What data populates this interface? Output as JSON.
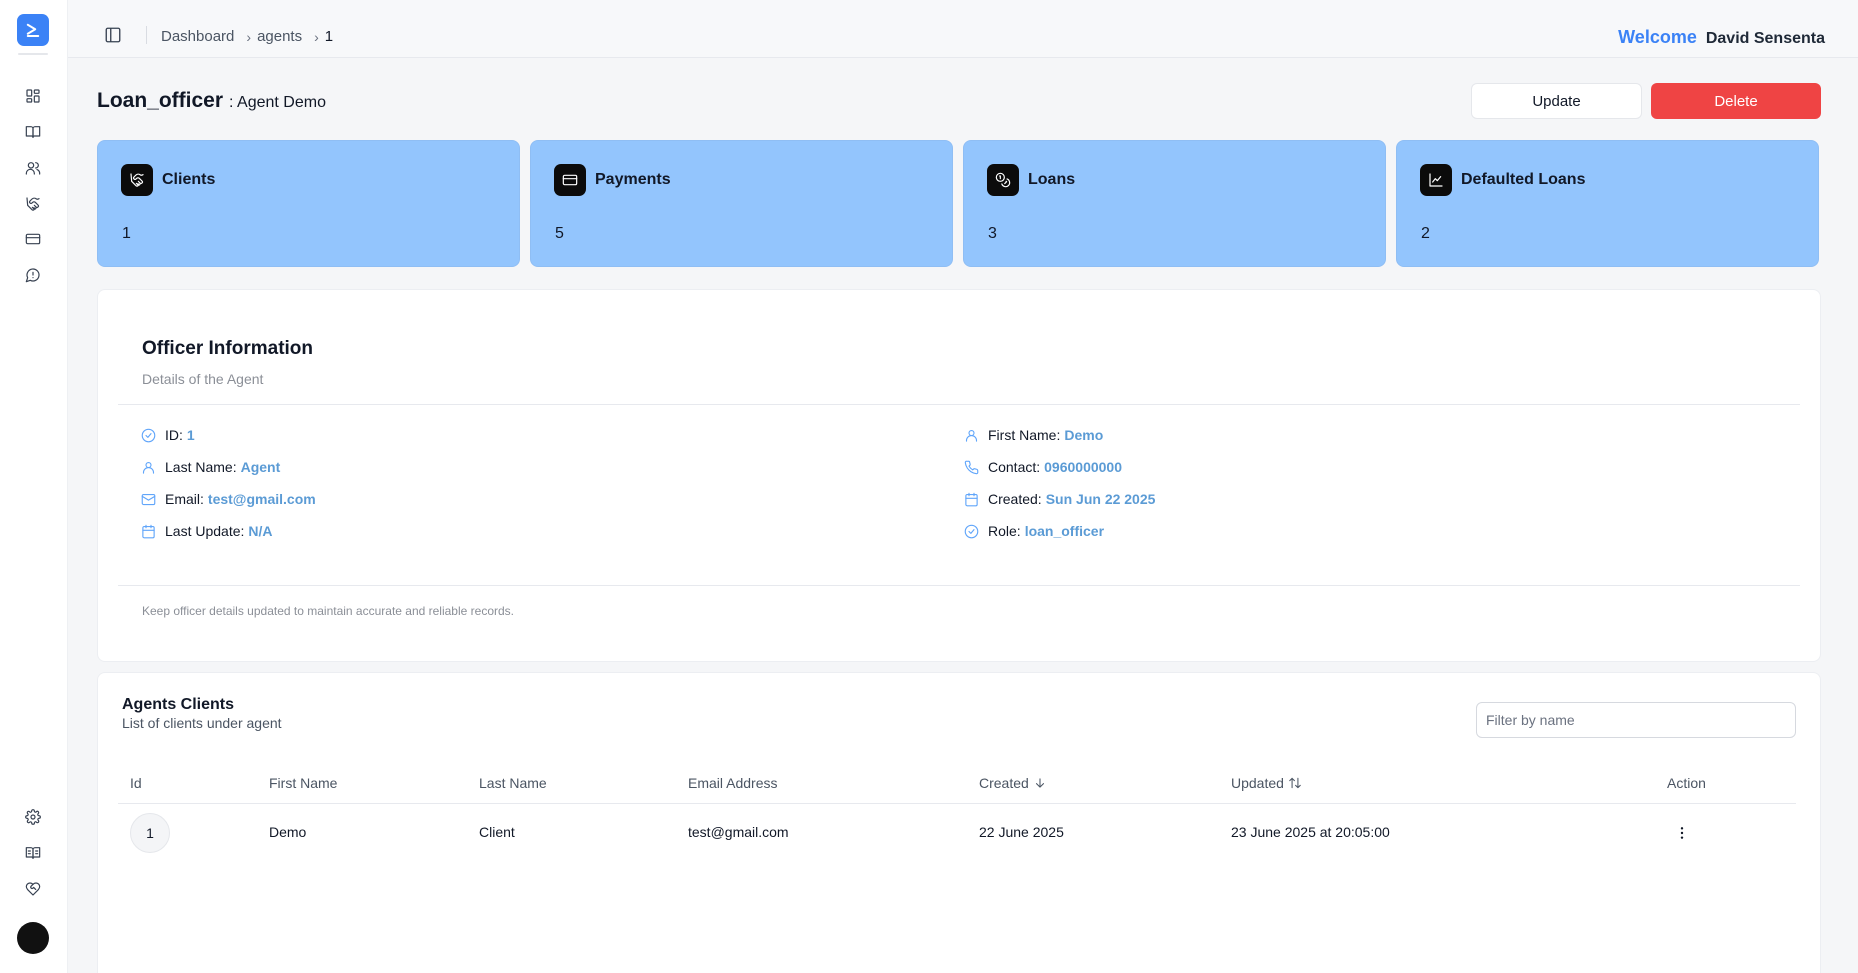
{
  "sidebar": {
    "nav_icons": [
      "grid-icon",
      "book-open-icon",
      "users-icon",
      "handshake-icon",
      "credit-card-icon",
      "message-icon"
    ],
    "bottom_icons": [
      "settings-icon",
      "book-icon",
      "heart-handshake-icon"
    ]
  },
  "header": {
    "breadcrumb": [
      "Dashboard",
      "agents",
      "1"
    ],
    "welcome_label": "Welcome",
    "user_name": "David Sensenta"
  },
  "page": {
    "role": "Loan_officer",
    "subtitle": ": Agent Demo",
    "update_label": "Update",
    "delete_label": "Delete"
  },
  "stats": [
    {
      "label": "Clients",
      "value": "1",
      "icon": "handshake-icon"
    },
    {
      "label": "Payments",
      "value": "5",
      "icon": "credit-card-icon"
    },
    {
      "label": "Loans",
      "value": "3",
      "icon": "coins-icon"
    },
    {
      "label": "Defaulted Loans",
      "value": "2",
      "icon": "line-chart-icon"
    }
  ],
  "officer": {
    "title": "Officer Information",
    "subtitle": "Details of the Agent",
    "fields": {
      "id": {
        "label": "ID:",
        "value": "1"
      },
      "first_name": {
        "label": "First Name:",
        "value": "Demo"
      },
      "last_name": {
        "label": "Last Name:",
        "value": "Agent"
      },
      "contact": {
        "label": "Contact:",
        "value": "0960000000"
      },
      "email": {
        "label": "Email:",
        "value": "test@gmail.com"
      },
      "created": {
        "label": "Created:",
        "value": "Sun Jun 22 2025"
      },
      "last_update": {
        "label": "Last Update:",
        "value": "N/A"
      },
      "role": {
        "label": "Role:",
        "value": "loan_officer"
      }
    },
    "note": "Keep officer details updated to maintain accurate and reliable records."
  },
  "clients": {
    "title": "Agents Clients",
    "subtitle": "List of clients under agent",
    "filter_placeholder": "Filter by name",
    "columns": [
      "Id",
      "First Name",
      "Last Name",
      "Email Address",
      "Created",
      "Updated",
      "Action"
    ],
    "rows": [
      {
        "id": "1",
        "first_name": "Demo",
        "last_name": "Client",
        "email": "test@gmail.com",
        "created": "22 June 2025",
        "updated": "23 June 2025 at 20:05:00"
      }
    ]
  },
  "colors": {
    "accent": "#3b82f6",
    "card_blue": "#93c5fd",
    "danger": "#ef4444",
    "link_value": "#5b9bd5"
  }
}
